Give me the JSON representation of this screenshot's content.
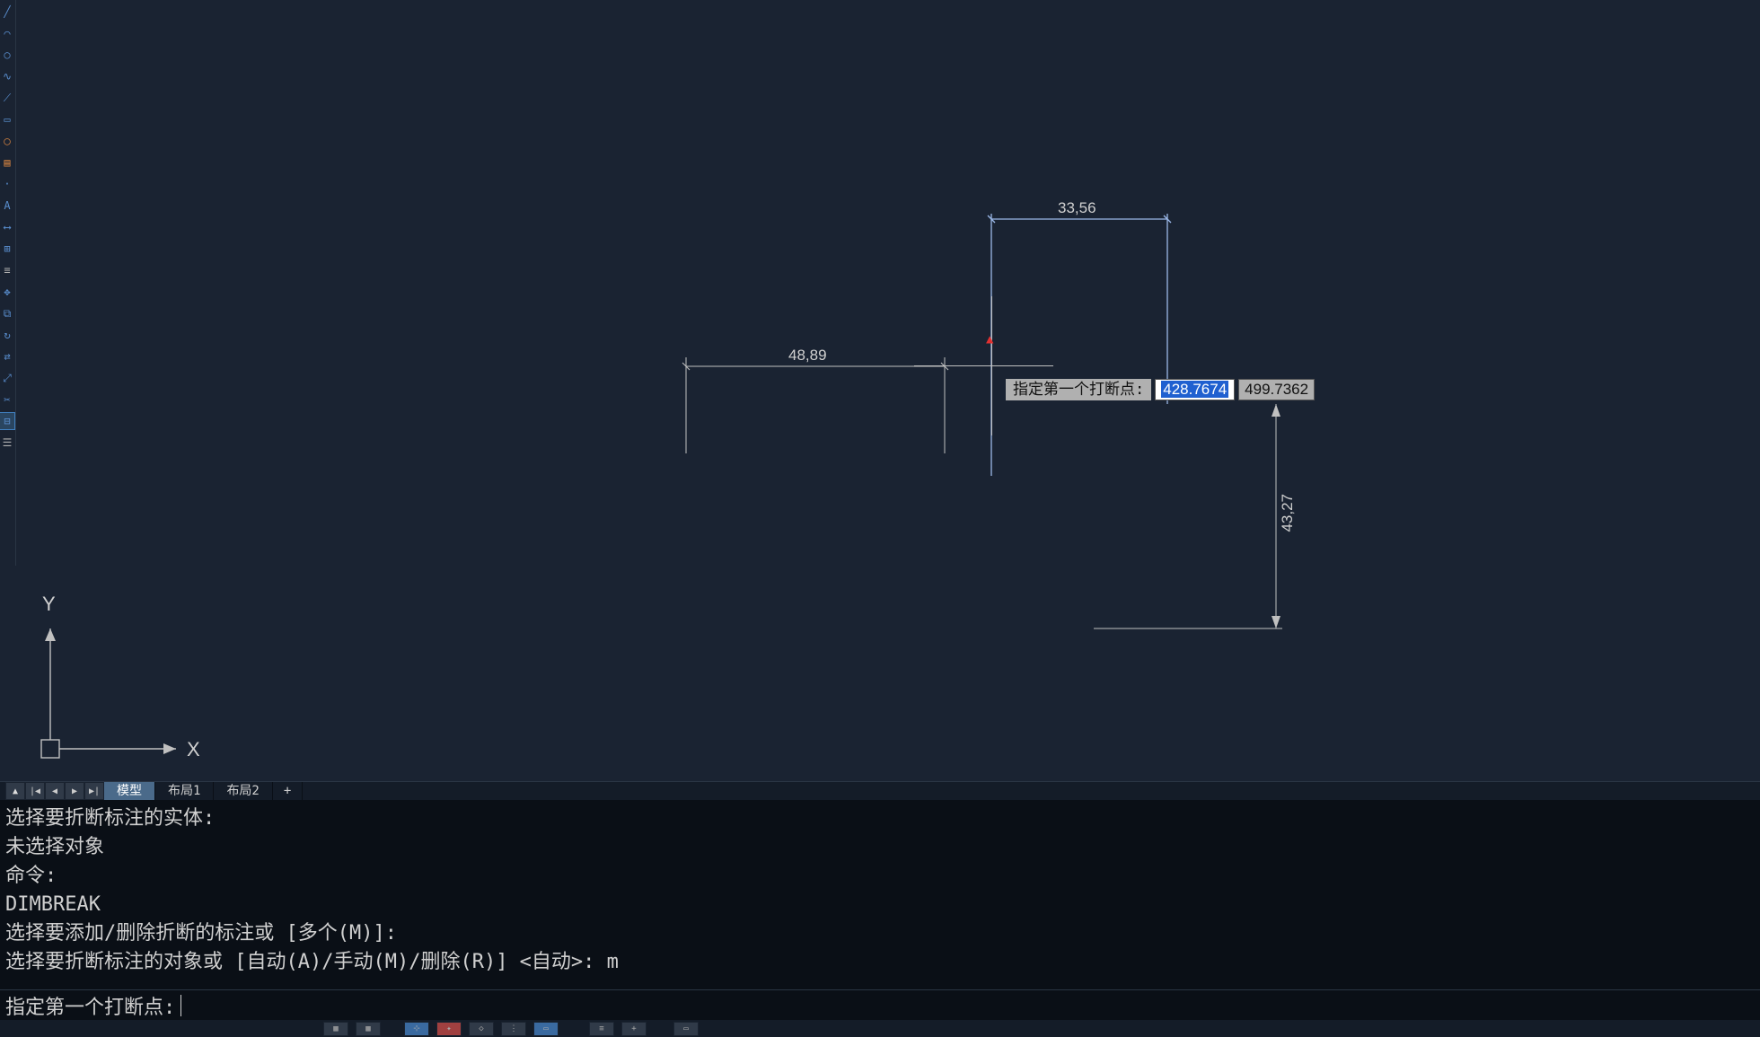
{
  "canvas": {
    "dimensions": {
      "top": {
        "value": "33,56"
      },
      "left": {
        "value": "48,89"
      },
      "right": {
        "value": "43,27"
      }
    },
    "dynamic_input": {
      "prompt": "指定第一个打断点:",
      "field1": "428.7674",
      "field2": "499.7362"
    },
    "ucs": {
      "x_label": "X",
      "y_label": "Y"
    }
  },
  "tabs": {
    "nav": {
      "first": "|◀",
      "prev": "◀",
      "next": "▶",
      "last": "▶|"
    },
    "items": [
      {
        "label": "模型",
        "active": true
      },
      {
        "label": "布局1",
        "active": false
      },
      {
        "label": "布局2",
        "active": false
      }
    ],
    "add": "+"
  },
  "command_history": {
    "lines": [
      "选择要折断标注的实体:",
      "未选择对象",
      "命令:",
      "DIMBREAK",
      "选择要添加/删除折断的标注或 [多个(M)]:",
      "选择要折断标注的对象或 [自动(A)/手动(M)/删除(R)] <自动>: m"
    ]
  },
  "command_input": {
    "prompt": "指定第一个打断点:"
  },
  "toolbar": {
    "icons": [
      "line",
      "arc",
      "circle",
      "spline",
      "rect",
      "ellipse",
      "hatch",
      "text",
      "dim",
      "table",
      "block",
      "layer",
      "props",
      "palette",
      "xref",
      "osnap"
    ]
  },
  "status": {
    "buttons": [
      "grid1",
      "grid2",
      "sep",
      "ortho",
      "polar",
      "sep",
      "osnap",
      "otrack",
      "dyn",
      "sep",
      "lwt",
      "sep",
      "model"
    ]
  }
}
